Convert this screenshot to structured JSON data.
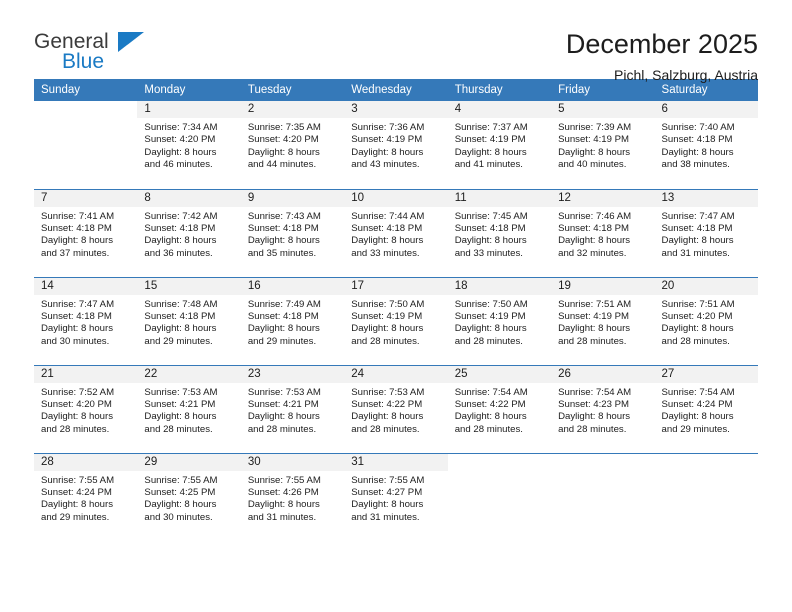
{
  "brand": {
    "name_part1": "General",
    "name_part2": "Blue",
    "triangle_color": "#1a7ac4"
  },
  "header": {
    "title": "December 2025",
    "subtitle": "Pichl, Salzburg, Austria"
  },
  "theme": {
    "header_bg": "#3579b9",
    "daynum_bg": "#f2f2f2",
    "row_divider": "#3579b9",
    "text": "#1d1d1d"
  },
  "weekday_headers": [
    "Sunday",
    "Monday",
    "Tuesday",
    "Wednesday",
    "Thursday",
    "Friday",
    "Saturday"
  ],
  "weeks": [
    [
      {
        "day": "",
        "sunrise": "",
        "sunset": "",
        "daylight1": "",
        "daylight2": ""
      },
      {
        "day": "1",
        "sunrise": "Sunrise: 7:34 AM",
        "sunset": "Sunset: 4:20 PM",
        "daylight1": "Daylight: 8 hours",
        "daylight2": "and 46 minutes."
      },
      {
        "day": "2",
        "sunrise": "Sunrise: 7:35 AM",
        "sunset": "Sunset: 4:20 PM",
        "daylight1": "Daylight: 8 hours",
        "daylight2": "and 44 minutes."
      },
      {
        "day": "3",
        "sunrise": "Sunrise: 7:36 AM",
        "sunset": "Sunset: 4:19 PM",
        "daylight1": "Daylight: 8 hours",
        "daylight2": "and 43 minutes."
      },
      {
        "day": "4",
        "sunrise": "Sunrise: 7:37 AM",
        "sunset": "Sunset: 4:19 PM",
        "daylight1": "Daylight: 8 hours",
        "daylight2": "and 41 minutes."
      },
      {
        "day": "5",
        "sunrise": "Sunrise: 7:39 AM",
        "sunset": "Sunset: 4:19 PM",
        "daylight1": "Daylight: 8 hours",
        "daylight2": "and 40 minutes."
      },
      {
        "day": "6",
        "sunrise": "Sunrise: 7:40 AM",
        "sunset": "Sunset: 4:18 PM",
        "daylight1": "Daylight: 8 hours",
        "daylight2": "and 38 minutes."
      }
    ],
    [
      {
        "day": "7",
        "sunrise": "Sunrise: 7:41 AM",
        "sunset": "Sunset: 4:18 PM",
        "daylight1": "Daylight: 8 hours",
        "daylight2": "and 37 minutes."
      },
      {
        "day": "8",
        "sunrise": "Sunrise: 7:42 AM",
        "sunset": "Sunset: 4:18 PM",
        "daylight1": "Daylight: 8 hours",
        "daylight2": "and 36 minutes."
      },
      {
        "day": "9",
        "sunrise": "Sunrise: 7:43 AM",
        "sunset": "Sunset: 4:18 PM",
        "daylight1": "Daylight: 8 hours",
        "daylight2": "and 35 minutes."
      },
      {
        "day": "10",
        "sunrise": "Sunrise: 7:44 AM",
        "sunset": "Sunset: 4:18 PM",
        "daylight1": "Daylight: 8 hours",
        "daylight2": "and 33 minutes."
      },
      {
        "day": "11",
        "sunrise": "Sunrise: 7:45 AM",
        "sunset": "Sunset: 4:18 PM",
        "daylight1": "Daylight: 8 hours",
        "daylight2": "and 33 minutes."
      },
      {
        "day": "12",
        "sunrise": "Sunrise: 7:46 AM",
        "sunset": "Sunset: 4:18 PM",
        "daylight1": "Daylight: 8 hours",
        "daylight2": "and 32 minutes."
      },
      {
        "day": "13",
        "sunrise": "Sunrise: 7:47 AM",
        "sunset": "Sunset: 4:18 PM",
        "daylight1": "Daylight: 8 hours",
        "daylight2": "and 31 minutes."
      }
    ],
    [
      {
        "day": "14",
        "sunrise": "Sunrise: 7:47 AM",
        "sunset": "Sunset: 4:18 PM",
        "daylight1": "Daylight: 8 hours",
        "daylight2": "and 30 minutes."
      },
      {
        "day": "15",
        "sunrise": "Sunrise: 7:48 AM",
        "sunset": "Sunset: 4:18 PM",
        "daylight1": "Daylight: 8 hours",
        "daylight2": "and 29 minutes."
      },
      {
        "day": "16",
        "sunrise": "Sunrise: 7:49 AM",
        "sunset": "Sunset: 4:18 PM",
        "daylight1": "Daylight: 8 hours",
        "daylight2": "and 29 minutes."
      },
      {
        "day": "17",
        "sunrise": "Sunrise: 7:50 AM",
        "sunset": "Sunset: 4:19 PM",
        "daylight1": "Daylight: 8 hours",
        "daylight2": "and 28 minutes."
      },
      {
        "day": "18",
        "sunrise": "Sunrise: 7:50 AM",
        "sunset": "Sunset: 4:19 PM",
        "daylight1": "Daylight: 8 hours",
        "daylight2": "and 28 minutes."
      },
      {
        "day": "19",
        "sunrise": "Sunrise: 7:51 AM",
        "sunset": "Sunset: 4:19 PM",
        "daylight1": "Daylight: 8 hours",
        "daylight2": "and 28 minutes."
      },
      {
        "day": "20",
        "sunrise": "Sunrise: 7:51 AM",
        "sunset": "Sunset: 4:20 PM",
        "daylight1": "Daylight: 8 hours",
        "daylight2": "and 28 minutes."
      }
    ],
    [
      {
        "day": "21",
        "sunrise": "Sunrise: 7:52 AM",
        "sunset": "Sunset: 4:20 PM",
        "daylight1": "Daylight: 8 hours",
        "daylight2": "and 28 minutes."
      },
      {
        "day": "22",
        "sunrise": "Sunrise: 7:53 AM",
        "sunset": "Sunset: 4:21 PM",
        "daylight1": "Daylight: 8 hours",
        "daylight2": "and 28 minutes."
      },
      {
        "day": "23",
        "sunrise": "Sunrise: 7:53 AM",
        "sunset": "Sunset: 4:21 PM",
        "daylight1": "Daylight: 8 hours",
        "daylight2": "and 28 minutes."
      },
      {
        "day": "24",
        "sunrise": "Sunrise: 7:53 AM",
        "sunset": "Sunset: 4:22 PM",
        "daylight1": "Daylight: 8 hours",
        "daylight2": "and 28 minutes."
      },
      {
        "day": "25",
        "sunrise": "Sunrise: 7:54 AM",
        "sunset": "Sunset: 4:22 PM",
        "daylight1": "Daylight: 8 hours",
        "daylight2": "and 28 minutes."
      },
      {
        "day": "26",
        "sunrise": "Sunrise: 7:54 AM",
        "sunset": "Sunset: 4:23 PM",
        "daylight1": "Daylight: 8 hours",
        "daylight2": "and 28 minutes."
      },
      {
        "day": "27",
        "sunrise": "Sunrise: 7:54 AM",
        "sunset": "Sunset: 4:24 PM",
        "daylight1": "Daylight: 8 hours",
        "daylight2": "and 29 minutes."
      }
    ],
    [
      {
        "day": "28",
        "sunrise": "Sunrise: 7:55 AM",
        "sunset": "Sunset: 4:24 PM",
        "daylight1": "Daylight: 8 hours",
        "daylight2": "and 29 minutes."
      },
      {
        "day": "29",
        "sunrise": "Sunrise: 7:55 AM",
        "sunset": "Sunset: 4:25 PM",
        "daylight1": "Daylight: 8 hours",
        "daylight2": "and 30 minutes."
      },
      {
        "day": "30",
        "sunrise": "Sunrise: 7:55 AM",
        "sunset": "Sunset: 4:26 PM",
        "daylight1": "Daylight: 8 hours",
        "daylight2": "and 31 minutes."
      },
      {
        "day": "31",
        "sunrise": "Sunrise: 7:55 AM",
        "sunset": "Sunset: 4:27 PM",
        "daylight1": "Daylight: 8 hours",
        "daylight2": "and 31 minutes."
      },
      {
        "day": "",
        "sunrise": "",
        "sunset": "",
        "daylight1": "",
        "daylight2": ""
      },
      {
        "day": "",
        "sunrise": "",
        "sunset": "",
        "daylight1": "",
        "daylight2": ""
      },
      {
        "day": "",
        "sunrise": "",
        "sunset": "",
        "daylight1": "",
        "daylight2": ""
      }
    ]
  ]
}
